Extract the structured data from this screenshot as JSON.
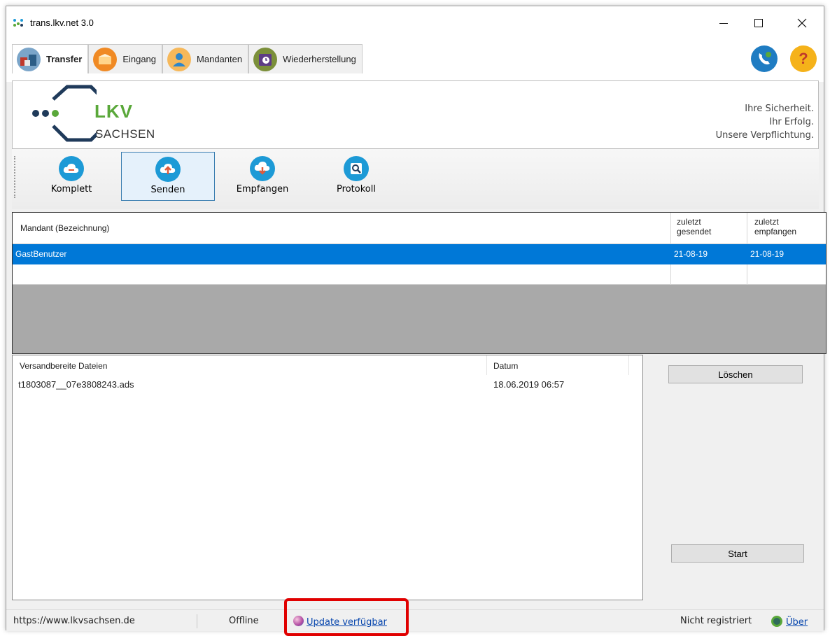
{
  "window": {
    "title": "trans.lkv.net 3.0"
  },
  "tabs": [
    {
      "label": "Transfer",
      "icon": "transfer-icon",
      "active": true
    },
    {
      "label": "Eingang",
      "icon": "inbox-icon",
      "active": false
    },
    {
      "label": "Mandanten",
      "icon": "user-icon",
      "active": false
    },
    {
      "label": "Wiederherstellung",
      "icon": "restore-icon",
      "active": false
    }
  ],
  "banner": {
    "logo_text": "LKV",
    "logo_sub": "SACHSEN",
    "slogan": [
      "Ihre Sicherheit.",
      "Ihr Erfolg.",
      "Unsere Verpflichtung."
    ]
  },
  "toolbar": {
    "items": [
      {
        "label": "Komplett",
        "icon": "cloud-sync-icon"
      },
      {
        "label": "Senden",
        "icon": "cloud-upload-icon",
        "active": true
      },
      {
        "label": "Empfangen",
        "icon": "cloud-download-icon"
      },
      {
        "label": "Protokoll",
        "icon": "log-search-icon"
      }
    ]
  },
  "mandant_table": {
    "headers": [
      "Mandant (Bezeichnung)",
      "zuletzt gesendet",
      "zuletzt empfangen"
    ],
    "header_sent_lines": [
      "zuletzt",
      "gesendet"
    ],
    "header_recv_lines": [
      "zuletzt",
      "empfangen"
    ],
    "rows": [
      {
        "name": "GastBenutzer",
        "sent": "21-08-19",
        "received": "21-08-19",
        "selected": true
      }
    ]
  },
  "files_table": {
    "headers": [
      "Versandbereite Dateien",
      "Datum"
    ],
    "rows": [
      {
        "file": "t1803087__07e3808243.ads",
        "date": "18.06.2019 06:57"
      }
    ]
  },
  "buttons": {
    "delete": "Löschen",
    "start": "Start"
  },
  "statusbar": {
    "url": "https://www.lkvsachsen.de",
    "connection": "Offline",
    "update_link": "Update verfügbar",
    "registration": "Nicht registriert",
    "about_link": "Über"
  },
  "colors": {
    "selection": "#0078d7",
    "brand_green": "#5aa83a",
    "brand_navy": "#1f3a5a",
    "icon_blue": "#1d9ad6",
    "highlight": "#e00000"
  }
}
